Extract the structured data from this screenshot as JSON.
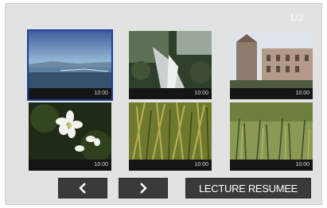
{
  "page_indicator": "1/2",
  "thumbnails": [
    {
      "scene": "seascape-sunset",
      "date": "",
      "time": "10:00",
      "selected": true
    },
    {
      "scene": "forest-stream",
      "date": "",
      "time": "10:00",
      "selected": false
    },
    {
      "scene": "old-buildings",
      "date": "",
      "time": "10:00",
      "selected": false
    },
    {
      "scene": "white-flowers",
      "date": "",
      "time": "10:00",
      "selected": false
    },
    {
      "scene": "grass-reeds",
      "date": "",
      "time": "10:00",
      "selected": false
    },
    {
      "scene": "field-grass",
      "date": "",
      "time": "10:00",
      "selected": false
    }
  ],
  "nav": {
    "prev_icon": "chevron-left-icon",
    "next_icon": "chevron-right-icon",
    "resume_label": "LECTURE RESUMEE"
  },
  "colors": {
    "background": "#e2e2e2",
    "selection": "#1f3e9a",
    "button": "#3a3a3a"
  }
}
